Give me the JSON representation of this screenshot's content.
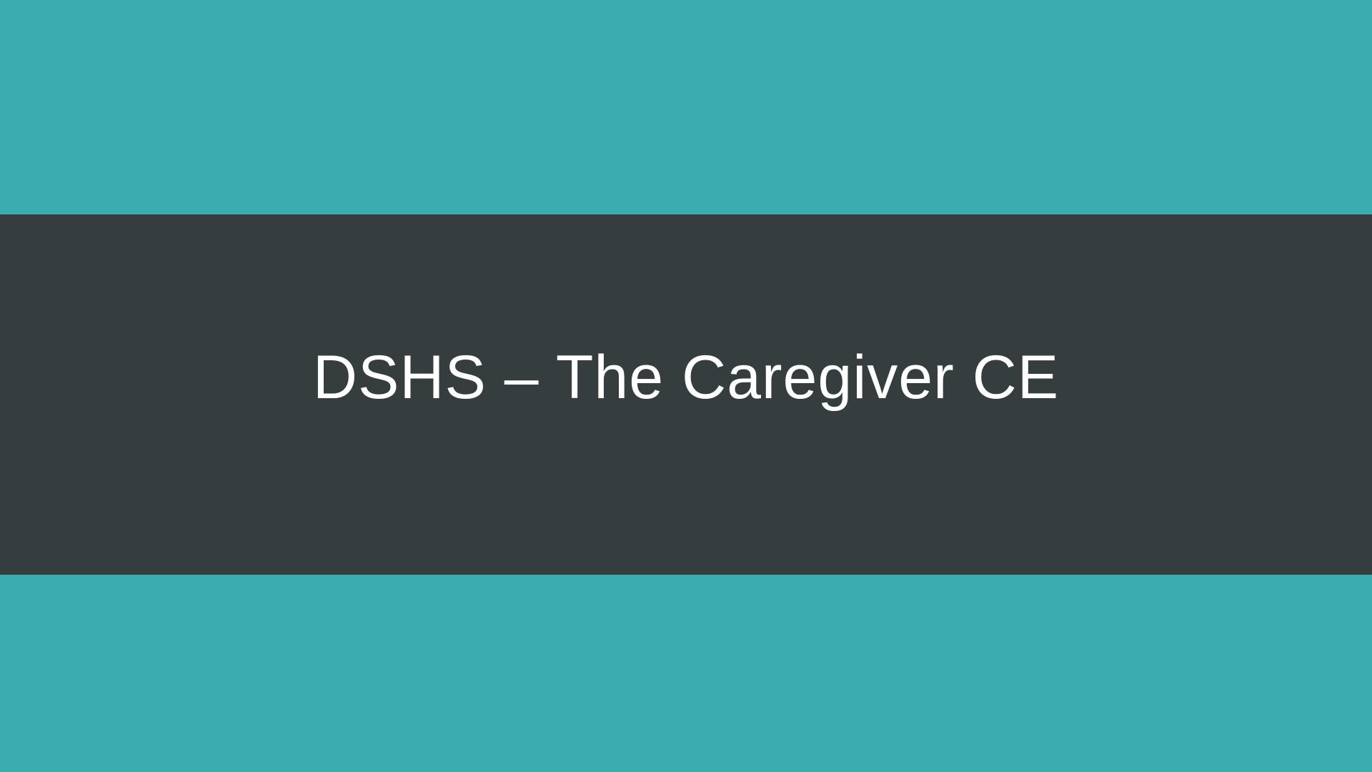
{
  "slide": {
    "title": "DSHS – The Caregiver CE"
  },
  "colors": {
    "background_teal": "#3aadb1",
    "band_dark": "#353d3f",
    "title_text": "#ffffff"
  }
}
